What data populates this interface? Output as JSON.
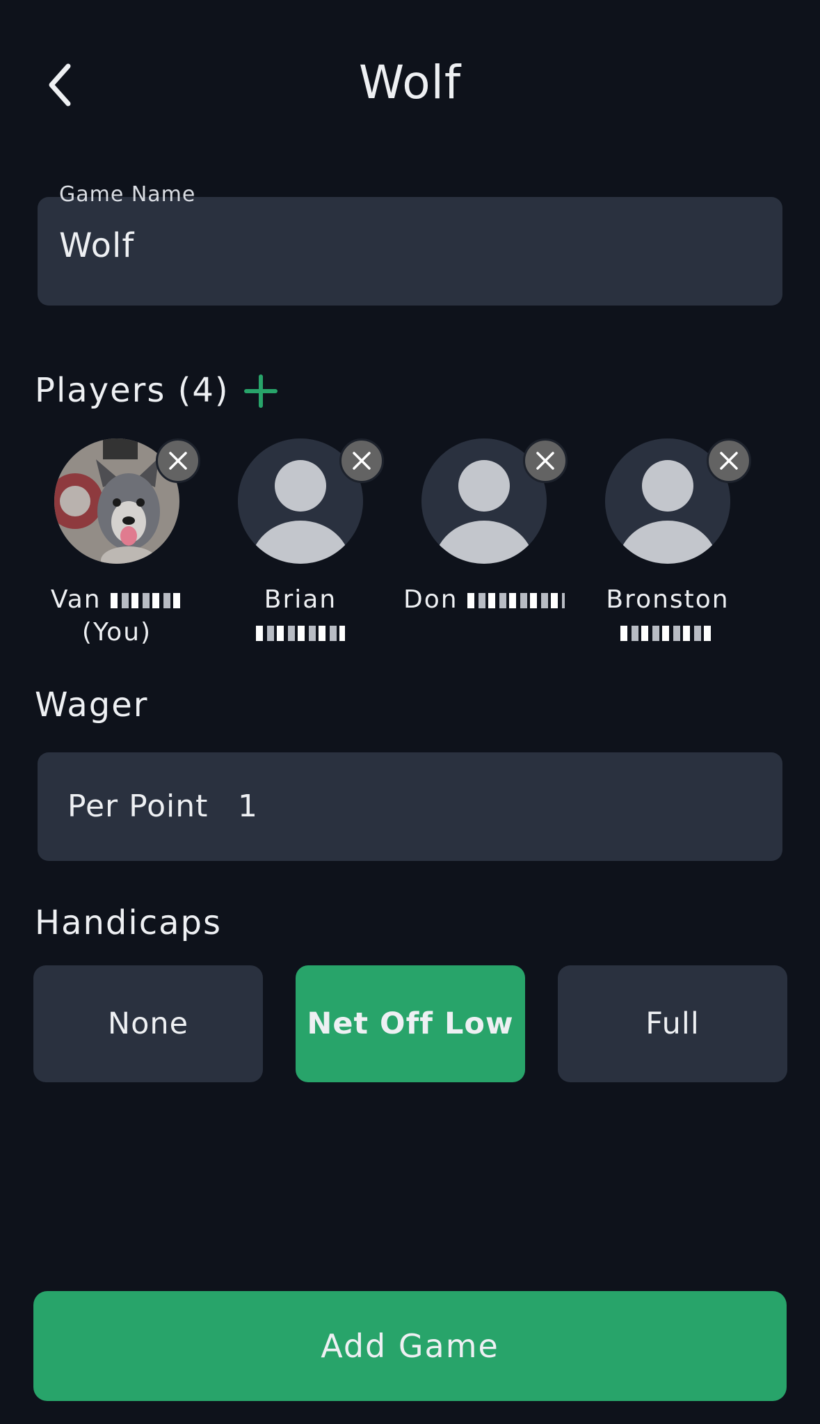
{
  "header": {
    "title": "Wolf",
    "back_icon": "chevron-left-icon"
  },
  "game_name": {
    "label": "Game Name",
    "value": "Wolf"
  },
  "players": {
    "heading": "Players (4)",
    "add_icon": "plus-icon",
    "accent_color": "#28a46a",
    "items": [
      {
        "first": "Van",
        "second": "(You)",
        "avatar": "dog-photo"
      },
      {
        "first": "Brian",
        "second": "",
        "avatar": "default-person-icon"
      },
      {
        "first": "Don",
        "second": "",
        "avatar": "default-person-icon"
      },
      {
        "first": "Bronston",
        "second": "",
        "avatar": "default-person-icon"
      }
    ]
  },
  "wager": {
    "heading": "Wager",
    "label": "Per Point",
    "value": "1"
  },
  "handicaps": {
    "heading": "Handicaps",
    "options": [
      "None",
      "Net Off Low",
      "Full"
    ],
    "selected": "Net Off Low"
  },
  "actions": {
    "add_game_label": "Add Game"
  },
  "colors": {
    "background": "#0e121b",
    "surface": "#2a313f",
    "accent": "#28a46a",
    "remove_badge": "#636363"
  }
}
